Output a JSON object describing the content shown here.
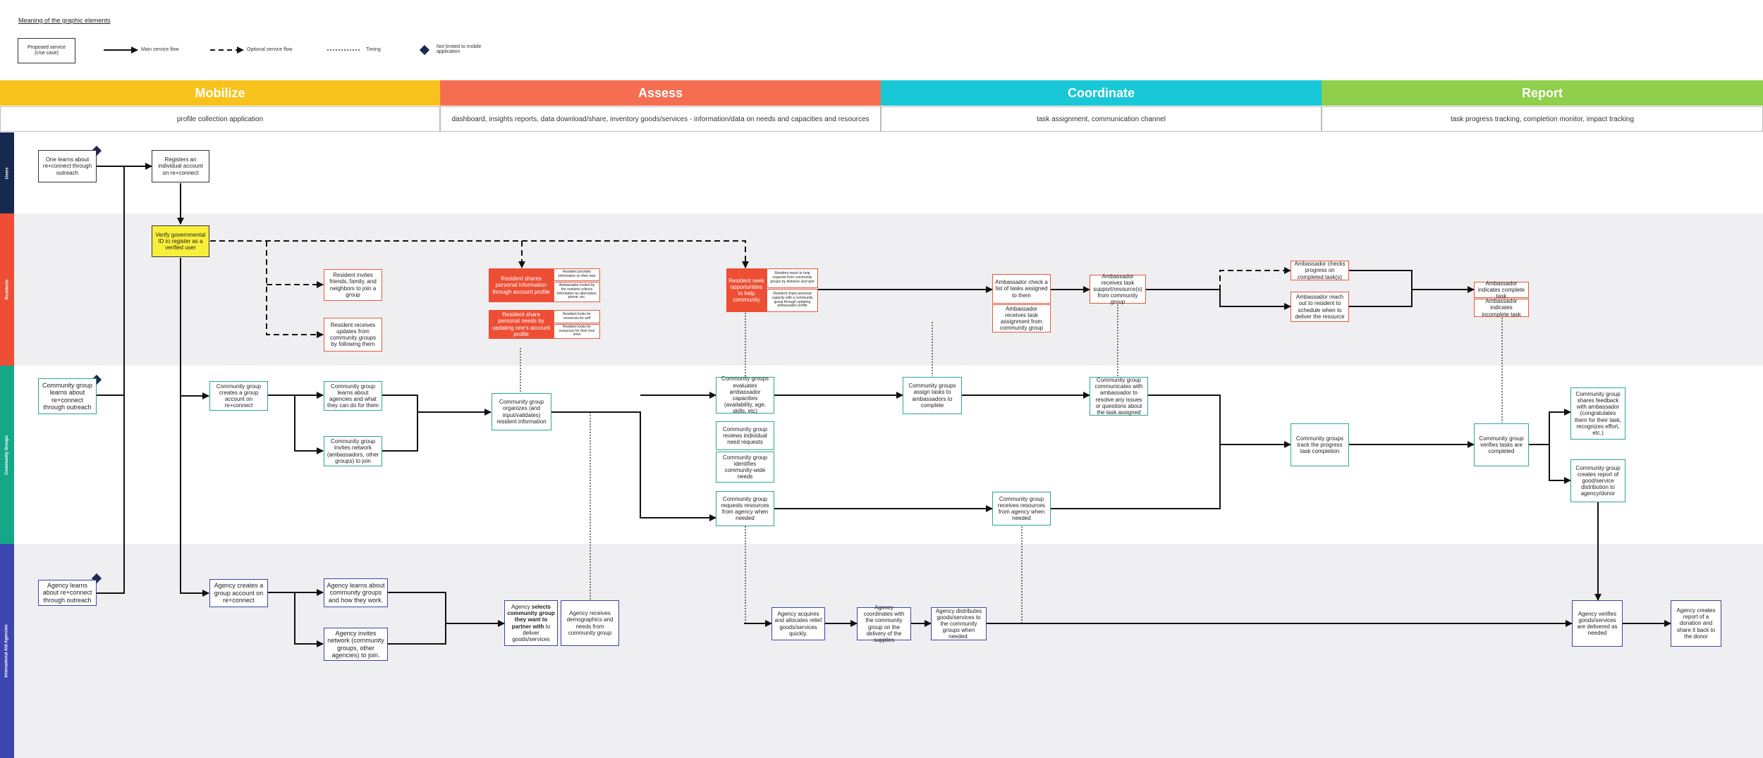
{
  "legend": {
    "title": "Meaning of the graphic elements",
    "proposed_service": "Proposed service\n(Use case)",
    "main_flow": "Main service flow",
    "optional_flow": "Optional service flow",
    "timing": "Timing",
    "not_limited": "Not limited to mobile application"
  },
  "phases": [
    {
      "name": "Mobilize",
      "subtitle": "profile collection application",
      "color": "#f7c21b"
    },
    {
      "name": "Assess",
      "subtitle": "dashboard, insights reports, data download/share, inventory goods/services - information/data on needs and capacities and resources",
      "color": "#f56e52"
    },
    {
      "name": "Coordinate",
      "subtitle": "task assignment, communication channel",
      "color": "#19c8d6"
    },
    {
      "name": "Report",
      "subtitle": "task progress tracking, completion monitor, impact tracking",
      "color": "#8fcf4c"
    }
  ],
  "lanes": [
    {
      "name": "Users",
      "color": "#162a50"
    },
    {
      "name": "Residents",
      "color": "#ee4e34"
    },
    {
      "name": "Community Groups",
      "color": "#14a889"
    },
    {
      "name": "International Aid Agencies",
      "color": "#3d46b0"
    }
  ],
  "nodes": {
    "u1": "One learns about re+connect through outreach",
    "u2": "Registers an individual account on re+connect",
    "r_verify": "Verify governmental ID to register as a verified user",
    "r_invite": "Resident invites friends, family, and neighbors to join a group",
    "r_updates": "Resident receives updates from community groups by following them",
    "r_share_info": "Resident shares personal information through account profile",
    "r_share_info_a": "Resident provides information on their own",
    "r_share_info_b": "Ambassador invited by the resident collects information by alternative, phone, etc.",
    "r_share_needs": "Resident share personal needs by updating one's account profile",
    "r_share_needs_a": "Resident looks for resources for self",
    "r_share_needs_b": "Resident looks for resources for their love ones",
    "r_seek": "Resident seek opportunities to help community",
    "r_seek_a": "Resident reach to help requests from community groups by distance and type",
    "r_seek_b": "Resident share personal capacity with a community group through updating ambassador profile",
    "r_check": "Ambassador check a list of tasks assigned to them",
    "r_receive_assign": "Ambassador receives task assignment from community group",
    "r_receive_support": "Ambassador receives task support/resource(s) from community group",
    "r_checks_progress": "Ambassador checks progress on completed task(s)",
    "r_reach_out": "Ambassador reach out to resident to schedule when to deliver the resource",
    "r_complete": "Ambassador indicates complete task",
    "r_incomplete": "Ambassador indicates incomplete task",
    "c_learn": "Community group learns about re+connect through outreach",
    "c_create": "Community group creates a group account on re+connect",
    "c_learns_agencies": "Community group learns about agencies and what they can do for them",
    "c_invites": "Community group invites network (ambassadors, other groups) to join",
    "c_organize": "Community group organizes (and input/validates) resident information",
    "c_evaluates": "Community groups evaluates ambassador capacities (availability, age, skills, etc)",
    "c_reviews": "Community group reviews individual need requests",
    "c_identifies": "Community group identifies community-wide needs",
    "c_requests": "Community group requests resources from agency when needed",
    "c_assign": "Community groups assign tasks to ambassadors to complete",
    "c_communicates": "Community group communicates with ambassador to resolve any issues or questions about the task assigned",
    "c_receives_res": "Community group receives resources from agency when needed",
    "c_track": "Community groups track the progress task completion",
    "c_verifies": "Community group verifies tasks are completed",
    "c_feedback": "Community group shares feedback with ambassador (congratulates them for their task, recognizes effort, etc.)",
    "c_report": "Community group creates report of good/service distribution to agency/donor",
    "a_learn": "Agency learns about re+connect through outreach",
    "a_create": "Agency creates a group account on re+connect",
    "a_learns_groups": "Agency learns about community groups and how they work.",
    "a_invites": "Agency invites network (community groups, other agencies) to join.",
    "a_selects_pre": "Agency ",
    "a_selects_b1": "selects community group",
    "a_selects_mid": " ",
    "a_selects_b2": "they want to partner with",
    "a_selects_post": " to deliver goods/services",
    "a_receives_demo": "Agency receives demographics and needs from community group",
    "a_acquires": "Agency acquires and allocates relief goods/services quickly.",
    "a_coordinates": "Agency coordinates with the community group on the delivery of the supplies",
    "a_distributes": "Agency distributes goods/services to the community groups when needed.",
    "a_verifies": "Agency verifies goods/services are delivered as needed",
    "a_report": "Agency creates report of a donation and share it back to the donor"
  }
}
